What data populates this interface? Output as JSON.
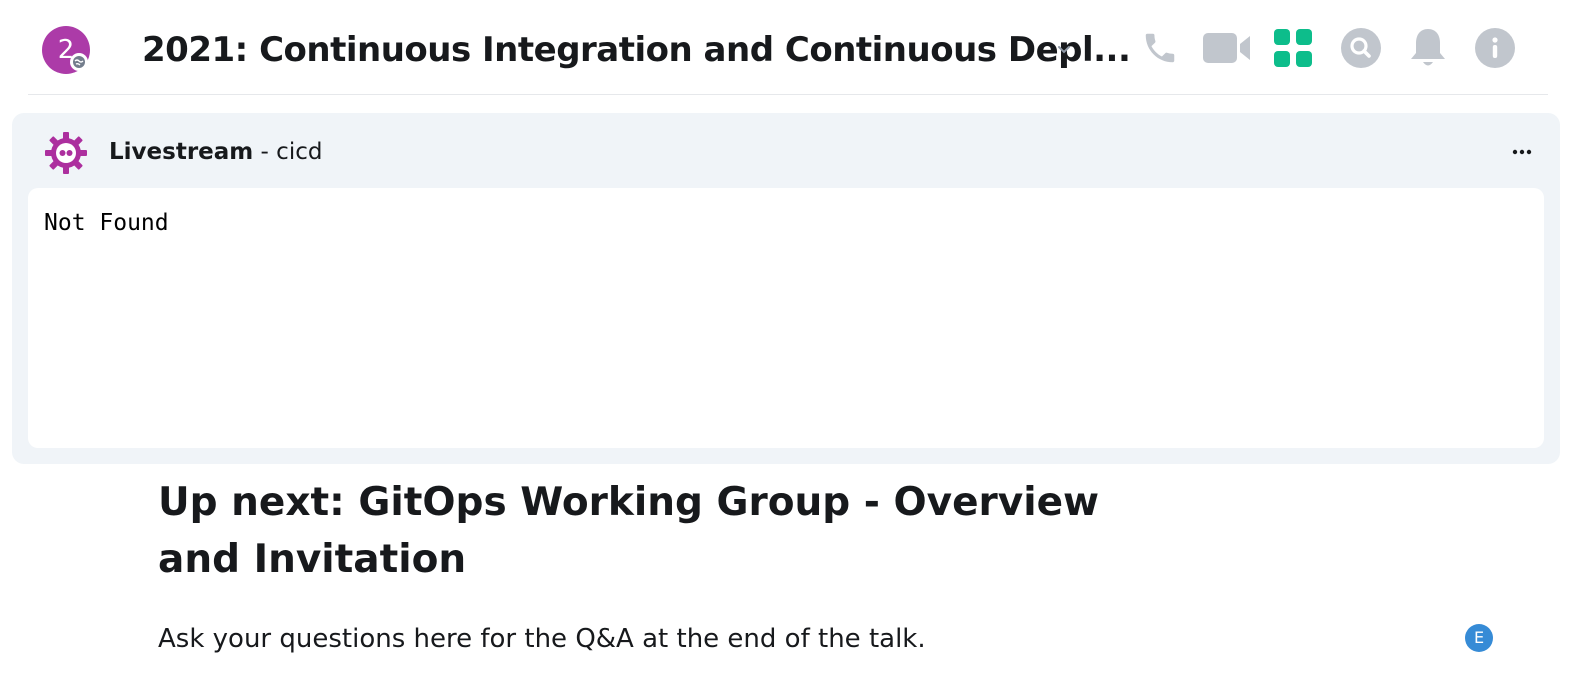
{
  "room": {
    "avatar_letter": "2",
    "name": "2021: Continuous Integration and Continuous Depl...",
    "avatar_color": "#ac3ba8"
  },
  "header_icons": [
    "phone-icon",
    "video-icon",
    "apps-icon",
    "search-icon",
    "bell-icon",
    "info-icon"
  ],
  "colors": {
    "accent": "#0dbd8b",
    "icon_gray": "#c1c6cd",
    "widget_bg": "#f0f4f8"
  },
  "widget": {
    "title_bold": "Livestream",
    "title_rest": " - cicd",
    "content": "Not Found"
  },
  "upnext": {
    "heading": "Up next: GitOps Working Group - Overview and Invitation",
    "subtext": "Ask your questions here for the Q&A at the end of the talk."
  },
  "read_receipt": {
    "letter": "E",
    "color": "#368bd6"
  }
}
